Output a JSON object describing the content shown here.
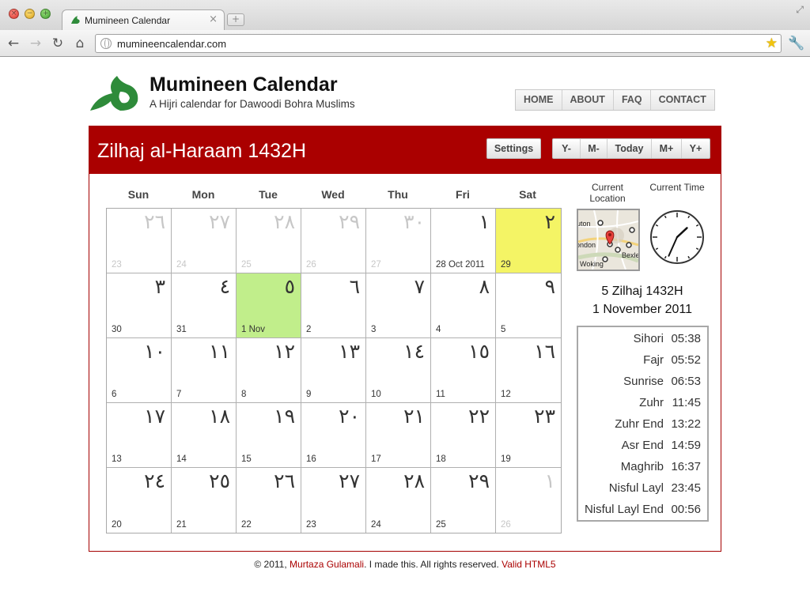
{
  "browser": {
    "tab_title": "Mumineen Calendar",
    "url": "mumineencalendar.com"
  },
  "site": {
    "title": "Mumineen Calendar",
    "tagline": "A Hijri calendar for Dawoodi Bohra Muslims",
    "nav": [
      "HOME",
      "ABOUT",
      "FAQ",
      "CONTACT"
    ]
  },
  "calendar": {
    "month_title": "Zilhaj al-Haraam 1432H",
    "settings_label": "Settings",
    "nav_buttons": [
      "Y-",
      "M-",
      "Today",
      "M+",
      "Y+"
    ],
    "weekdays": [
      "Sun",
      "Mon",
      "Tue",
      "Wed",
      "Thu",
      "Fri",
      "Sat"
    ],
    "weeks": [
      [
        {
          "hijri": "٢٦",
          "greg": "23",
          "other": true
        },
        {
          "hijri": "٢٧",
          "greg": "24",
          "other": true
        },
        {
          "hijri": "٢٨",
          "greg": "25",
          "other": true
        },
        {
          "hijri": "٢٩",
          "greg": "26",
          "other": true
        },
        {
          "hijri": "٣٠",
          "greg": "27",
          "other": true
        },
        {
          "hijri": "١",
          "greg": "28 Oct 2011"
        },
        {
          "hijri": "٢",
          "greg": "29",
          "highlight": "yellow"
        }
      ],
      [
        {
          "hijri": "٣",
          "greg": "30"
        },
        {
          "hijri": "٤",
          "greg": "31"
        },
        {
          "hijri": "٥",
          "greg": "1 Nov",
          "highlight": "green"
        },
        {
          "hijri": "٦",
          "greg": "2"
        },
        {
          "hijri": "٧",
          "greg": "3"
        },
        {
          "hijri": "٨",
          "greg": "4"
        },
        {
          "hijri": "٩",
          "greg": "5"
        }
      ],
      [
        {
          "hijri": "١٠",
          "greg": "6"
        },
        {
          "hijri": "١١",
          "greg": "7"
        },
        {
          "hijri": "١٢",
          "greg": "8"
        },
        {
          "hijri": "١٣",
          "greg": "9"
        },
        {
          "hijri": "١٤",
          "greg": "10"
        },
        {
          "hijri": "١٥",
          "greg": "11"
        },
        {
          "hijri": "١٦",
          "greg": "12"
        }
      ],
      [
        {
          "hijri": "١٧",
          "greg": "13"
        },
        {
          "hijri": "١٨",
          "greg": "14"
        },
        {
          "hijri": "١٩",
          "greg": "15"
        },
        {
          "hijri": "٢٠",
          "greg": "16"
        },
        {
          "hijri": "٢١",
          "greg": "17"
        },
        {
          "hijri": "٢٢",
          "greg": "18"
        },
        {
          "hijri": "٢٣",
          "greg": "19"
        }
      ],
      [
        {
          "hijri": "٢٤",
          "greg": "20"
        },
        {
          "hijri": "٢٥",
          "greg": "21"
        },
        {
          "hijri": "٢٦",
          "greg": "22"
        },
        {
          "hijri": "٢٧",
          "greg": "23"
        },
        {
          "hijri": "٢٨",
          "greg": "24"
        },
        {
          "hijri": "٢٩",
          "greg": "25"
        },
        {
          "hijri": "١",
          "greg": "26",
          "other": true
        }
      ]
    ]
  },
  "sidebar": {
    "location_label": "Current Location",
    "time_label": "Current Time",
    "map_labels": [
      "uton",
      "ondon",
      "Woking",
      "Bexle"
    ],
    "clock": {
      "hour": 1,
      "minute": 34
    },
    "today_hijri": "5 Zilhaj 1432H",
    "today_greg": "1 November 2011",
    "prayer_times": [
      {
        "name": "Sihori",
        "time": "05:38"
      },
      {
        "name": "Fajr",
        "time": "05:52"
      },
      {
        "name": "Sunrise",
        "time": "06:53"
      },
      {
        "name": "Zuhr",
        "time": "11:45"
      },
      {
        "name": "Zuhr End",
        "time": "13:22"
      },
      {
        "name": "Asr End",
        "time": "14:59"
      },
      {
        "name": "Maghrib",
        "time": "16:37"
      },
      {
        "name": "Nisful Layl",
        "time": "23:45"
      },
      {
        "name": "Nisful Layl End",
        "time": "00:56"
      }
    ]
  },
  "footer": {
    "copyright": "© 2011, ",
    "author": "Murtaza Gulamali",
    "rest": ". I made this. All rights reserved. ",
    "valid": "Valid HTML5"
  },
  "colors": {
    "brand_red": "#aa0000",
    "today_green": "#c1ee8b",
    "weekend_yellow": "#f4f465",
    "logo_green": "#2e8b3a"
  }
}
